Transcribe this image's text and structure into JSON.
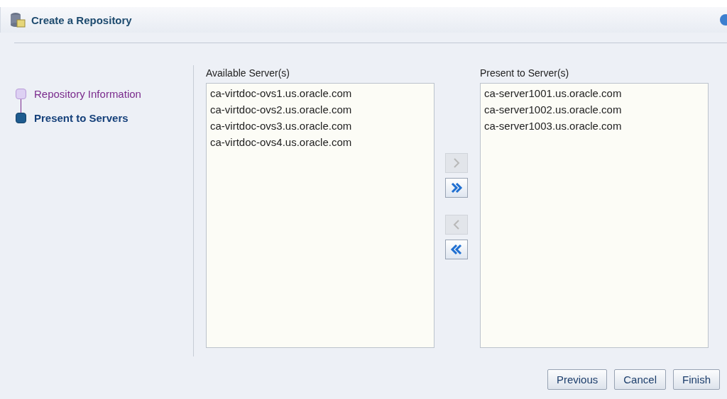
{
  "dialog": {
    "title": "Create a Repository"
  },
  "steps": [
    {
      "label": "Repository Information",
      "selected": false
    },
    {
      "label": "Present to Servers",
      "selected": true
    }
  ],
  "available": {
    "label": "Available Server(s)",
    "items": [
      "ca-virtdoc-ovs1.us.oracle.com",
      "ca-virtdoc-ovs2.us.oracle.com",
      "ca-virtdoc-ovs3.us.oracle.com",
      "ca-virtdoc-ovs4.us.oracle.com"
    ]
  },
  "present": {
    "label": "Present to Server(s)",
    "items": [
      "ca-server1001.us.oracle.com",
      "ca-server1002.us.oracle.com",
      "ca-server1003.us.oracle.com"
    ]
  },
  "shuttle": [
    {
      "kind": "move-right",
      "disabled": true
    },
    {
      "kind": "move-all-right",
      "disabled": false
    },
    {
      "kind": "move-left",
      "disabled": true
    },
    {
      "kind": "move-all-left",
      "disabled": false
    }
  ],
  "buttons": [
    "Previous",
    "Cancel",
    "Finish"
  ]
}
